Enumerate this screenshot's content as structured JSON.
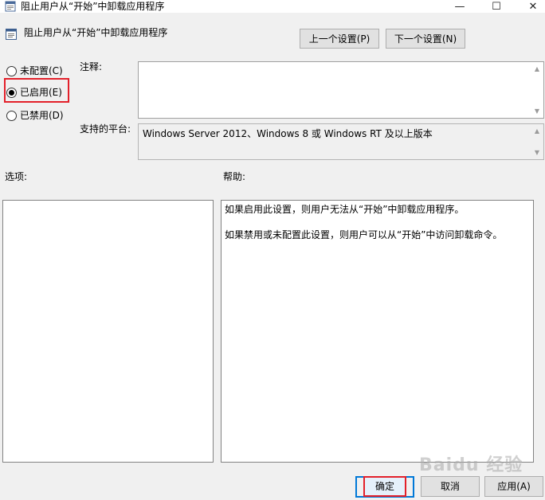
{
  "window": {
    "title": "阻止用户从“开始”中卸载应用程序",
    "minimize_glyph": "—",
    "maximize_glyph": "☐",
    "close_glyph": "✕"
  },
  "header": {
    "policy_title": "阻止用户从“开始”中卸载应用程序",
    "prev_button": "上一个设置(P)",
    "next_button": "下一个设置(N)"
  },
  "state": {
    "options": [
      {
        "label": "未配置(C)",
        "selected": false
      },
      {
        "label": "已启用(E)",
        "selected": true
      },
      {
        "label": "已禁用(D)",
        "selected": false
      }
    ]
  },
  "comment": {
    "label": "注释:",
    "value": ""
  },
  "platform": {
    "label": "支持的平台:",
    "value": "Windows Server 2012、Windows 8 或 Windows RT 及以上版本"
  },
  "options_panel": {
    "label": "选项:"
  },
  "help_panel": {
    "label": "帮助:",
    "lines": [
      "如果启用此设置，则用户无法从“开始”中卸载应用程序。",
      "如果禁用或未配置此设置，则用户可以从“开始”中访问卸载命令。"
    ]
  },
  "footer": {
    "ok": "确定",
    "cancel": "取消",
    "apply": "应用(A)"
  },
  "watermark": "Baidu 经验",
  "colors": {
    "highlight": "#e3202a",
    "focus": "#0078d7",
    "dialog_bg": "#f0f0f0"
  }
}
